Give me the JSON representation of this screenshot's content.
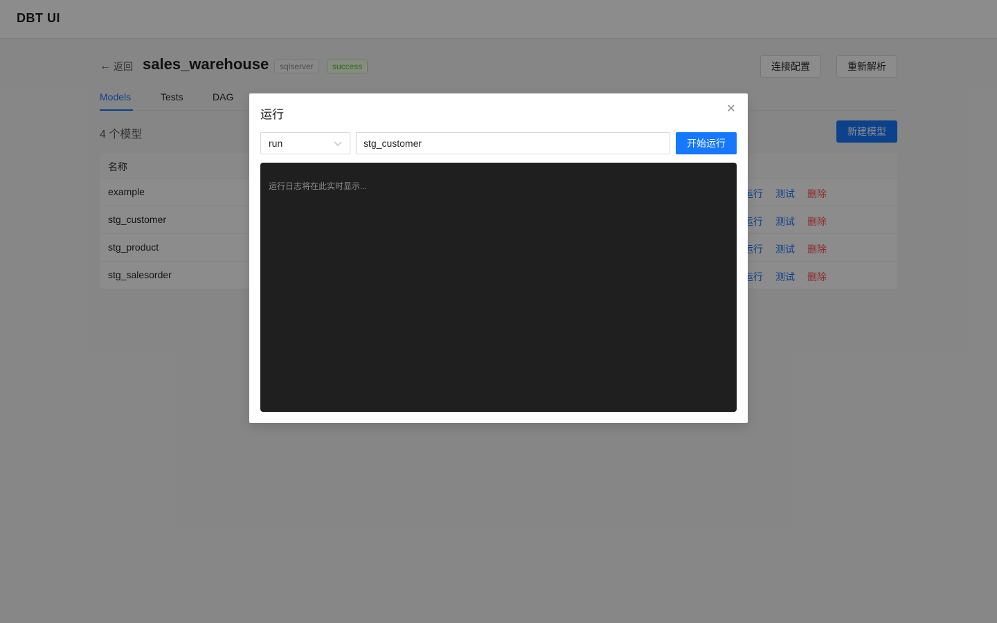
{
  "app": {
    "brand": "DBT UI"
  },
  "header": {
    "back_label": "返回",
    "project_name": "sales_warehouse",
    "db_tag": "sqlserver",
    "status_tag": "success",
    "connection_button": "连接配置",
    "reparse_button": "重新解析"
  },
  "tabs": [
    {
      "label": "Models",
      "active": true
    },
    {
      "label": "Tests"
    },
    {
      "label": "DAG"
    }
  ],
  "models": {
    "count_label": "4 个模型",
    "new_button": "新建模型",
    "columns": {
      "name": "名称"
    },
    "rows": [
      {
        "name": "example"
      },
      {
        "name": "stg_customer"
      },
      {
        "name": "stg_product"
      },
      {
        "name": "stg_salesorder"
      }
    ],
    "actions": {
      "run": "运行",
      "test": "测试",
      "delete": "删除"
    }
  },
  "modal": {
    "title": "运行",
    "command_value": "run",
    "target_value": "stg_customer",
    "start_button": "开始运行",
    "log_placeholder": "运行日志将在此实时显示..."
  },
  "colors": {
    "primary": "#1677ff",
    "danger": "#ff4d4f",
    "success": "#52c41a",
    "log_bg": "#1f1f1f"
  }
}
